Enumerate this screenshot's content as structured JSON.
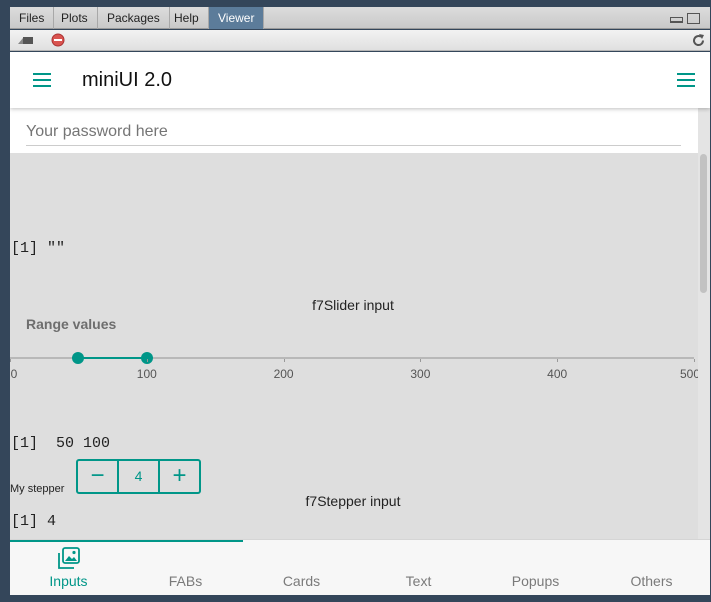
{
  "rstudio": {
    "tabs": [
      {
        "label": "Files",
        "active": false
      },
      {
        "label": "Plots",
        "active": false
      },
      {
        "label": "Packages",
        "active": false
      },
      {
        "label": "Help",
        "active": false
      },
      {
        "label": "Viewer",
        "active": true
      }
    ],
    "toolbar_icons": [
      "broom-icon",
      "stop-icon",
      "refresh-icon"
    ]
  },
  "app": {
    "title": "miniUI 2.0",
    "accent": "#009688",
    "password": {
      "placeholder": "Your password here",
      "value": ""
    },
    "password_output": "[1] \"\"",
    "slider": {
      "section_title": "f7Slider input",
      "label": "Range values",
      "min": 0,
      "max": 500,
      "value": [
        50,
        100
      ],
      "tick_labels": [
        "0",
        "100",
        "200",
        "300",
        "400",
        "500"
      ],
      "output": "[1]  50 100"
    },
    "stepper": {
      "section_title": "f7Stepper input",
      "label": "My stepper",
      "value": "4",
      "minus_symbol": "−",
      "plus_symbol": "+",
      "output": "[1] 4"
    },
    "bottom_tabs": [
      {
        "label": "Inputs",
        "active": true,
        "icon": "photos-icon"
      },
      {
        "label": "FABs",
        "active": false
      },
      {
        "label": "Cards",
        "active": false
      },
      {
        "label": "Text",
        "active": false
      },
      {
        "label": "Popups",
        "active": false
      },
      {
        "label": "Others",
        "active": false
      }
    ]
  }
}
